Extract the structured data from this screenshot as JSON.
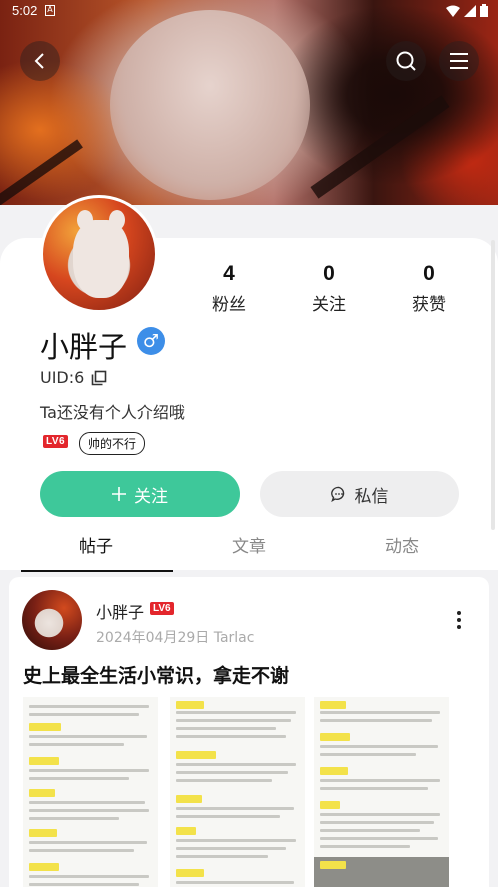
{
  "status_bar": {
    "time": "5:02",
    "notification": "A"
  },
  "header": {
    "back_icon": "chevron-left-icon",
    "search_icon": "search-icon",
    "menu_icon": "menu-icon"
  },
  "profile": {
    "name": "小胖子",
    "gender_symbol": "♂",
    "uid": "UID:6",
    "bio": "Ta还没有个人介绍哦",
    "level": "LV6",
    "tag": "帅的不行",
    "stats": [
      {
        "value": "4",
        "label": "粉丝"
      },
      {
        "value": "0",
        "label": "关注"
      },
      {
        "value": "0",
        "label": "获赞"
      }
    ],
    "follow_label": "关注",
    "message_label": "私信"
  },
  "tabs": [
    {
      "label": "帖子",
      "active": true
    },
    {
      "label": "文章",
      "active": false
    },
    {
      "label": "动态",
      "active": false
    }
  ],
  "post": {
    "author": "小胖子",
    "level": "LV6",
    "meta": "2024年04月29日 Tarlac",
    "title": "史上最全生活小常识，拿走不谢"
  },
  "colors": {
    "accent": "#3ec89a",
    "level_badge": "#e3262c",
    "gender": "#3d8ee8"
  }
}
